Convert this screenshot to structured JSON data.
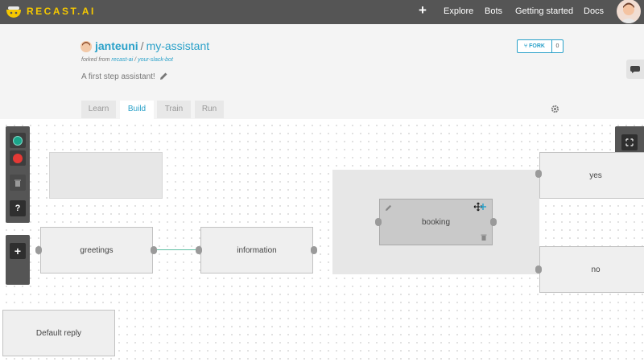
{
  "brand": {
    "name": "RECAST.AI"
  },
  "nav": {
    "add_icon": "plus-icon",
    "links": [
      "Explore",
      "Bots",
      "Getting started",
      "Docs"
    ]
  },
  "repo": {
    "owner": "janteuni",
    "separator": "/",
    "name": "my-assistant",
    "forked_prefix": "forked from",
    "forked_owner": "recast-ai",
    "forked_separator": "/",
    "forked_repo": "your-slack-bot",
    "description": "A first step assistant!",
    "fork_label": "FORK",
    "fork_count": "0"
  },
  "tabs": [
    {
      "label": "Learn",
      "active": false
    },
    {
      "label": "Build",
      "active": true
    },
    {
      "label": "Train",
      "active": false
    },
    {
      "label": "Run",
      "active": false
    }
  ],
  "toolbar": {
    "help_label": "?",
    "add_label": "+",
    "colors": [
      "#1aa58a",
      "#e53935"
    ]
  },
  "nodes": {
    "greetings": "greetings",
    "information": "information",
    "booking": "booking",
    "yes": "yes",
    "no": "no",
    "default_reply": "Default reply"
  },
  "colors": {
    "accent": "#2aa1c9",
    "brand": "#f5c800",
    "topbar": "#555555",
    "connector": "#5fbfa3"
  }
}
